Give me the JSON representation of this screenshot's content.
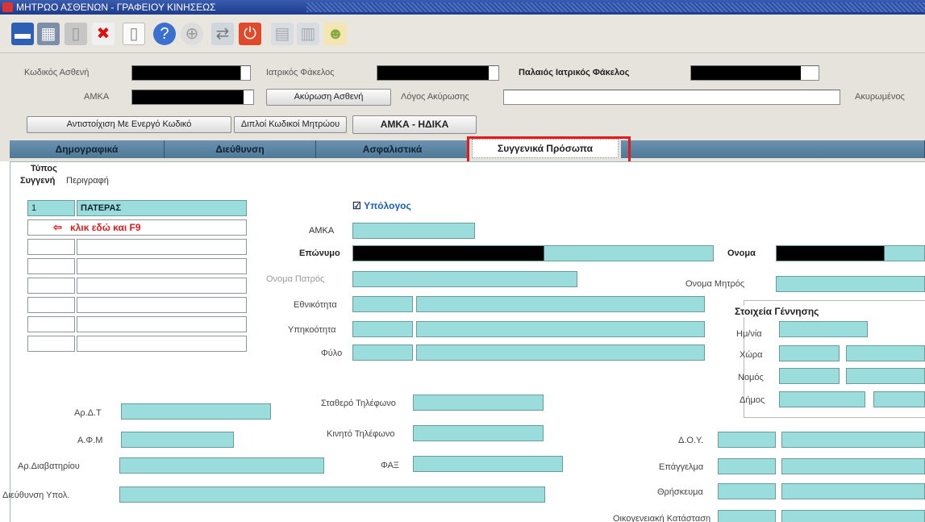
{
  "window": {
    "title": "ΜΗΤΡΩΟ ΑΣΘΕΝΩΝ - ΓΡΑΦΕΙΟΥ ΚΙΝΗΣΕΩΣ"
  },
  "toolbar": {
    "icons": [
      "save-icon",
      "print-icon",
      "copy-icon",
      "delete-icon",
      "new-icon",
      "help-icon",
      "zoom-icon",
      "exit-icon",
      "power-icon",
      "window-icon",
      "window2-icon",
      "users-icon"
    ]
  },
  "header": {
    "patient_code_label": "Κωδικός Ασθενή",
    "medical_folder_label": "Ιατρικός Φάκελος",
    "old_medical_folder_label": "Παλαιός Ιατρικός Φάκελος",
    "amka_label": "ΑΜΚΑ",
    "cancel_patient_button": "Ακύρωση Ασθενή",
    "cancel_reason_label": "Λόγος Ακύρωσης",
    "canceled_label": "Ακυρωμένος",
    "match_active_code_button": "Αντιστοίχιση Με Ενεργό Κωδικό",
    "duplicate_codes_button": "Διπλοί Κωδικοί Μητρώου",
    "amka_idika_button": "ΑΜΚΑ - ΗΔΙΚΑ"
  },
  "tabs": [
    {
      "label": "Δημογραφικά"
    },
    {
      "label": "Διεύθυνση"
    },
    {
      "label": "Ασφαλιστικά"
    },
    {
      "label": "Συγγενικά Πρόσωπα"
    }
  ],
  "relatives": {
    "type_header": "Τύπος",
    "relative_header": "Συγγενή",
    "description_header": "Περιγραφή",
    "rows": [
      {
        "code": "1",
        "desc": "ΠΑΤΕΡΑΣ"
      }
    ],
    "hint": "κλικ εδώ και F9"
  },
  "form": {
    "responsible_label": "Υπόλογος",
    "amka_label": "ΑΜΚΑ",
    "surname_label": "Επώνυμο",
    "name_label": "Ονομα",
    "father_label": "Ονομα Πατρός",
    "mother_label": "Ονομα Μητρός",
    "nationality_label": "Εθνικότητα",
    "citizenship_label": "Υπηκοότητα",
    "gender_label": "Φύλο",
    "birth_title": "Στοιχεία Γέννησης",
    "birth_date_label": "Ημ/νία",
    "country_label": "Χώρα",
    "prefecture_label": "Νομός",
    "municipality_label": "Δήμος",
    "id_label": "Αρ.Δ.Τ",
    "afm_label": "Α.Φ.Μ",
    "passport_label": "Αρ.Διαβατηρίου",
    "address_label": "Διεύθυνση Υπολ.",
    "landline_label": "Σταθερό Τηλέφωνο",
    "mobile_label": "Κινητό Τηλέφωνο",
    "fax_label": "ΦΑΞ",
    "doy_label": "Δ.Ο.Υ.",
    "profession_label": "Επάγγελμα",
    "religion_label": "Θρήσκευμα",
    "family_status_label": "Οικογενειακή Κατάσταση"
  },
  "colors": {
    "field": "#9bdcdc",
    "highlight": "#e31b1b",
    "tab": "#5a84a2"
  }
}
